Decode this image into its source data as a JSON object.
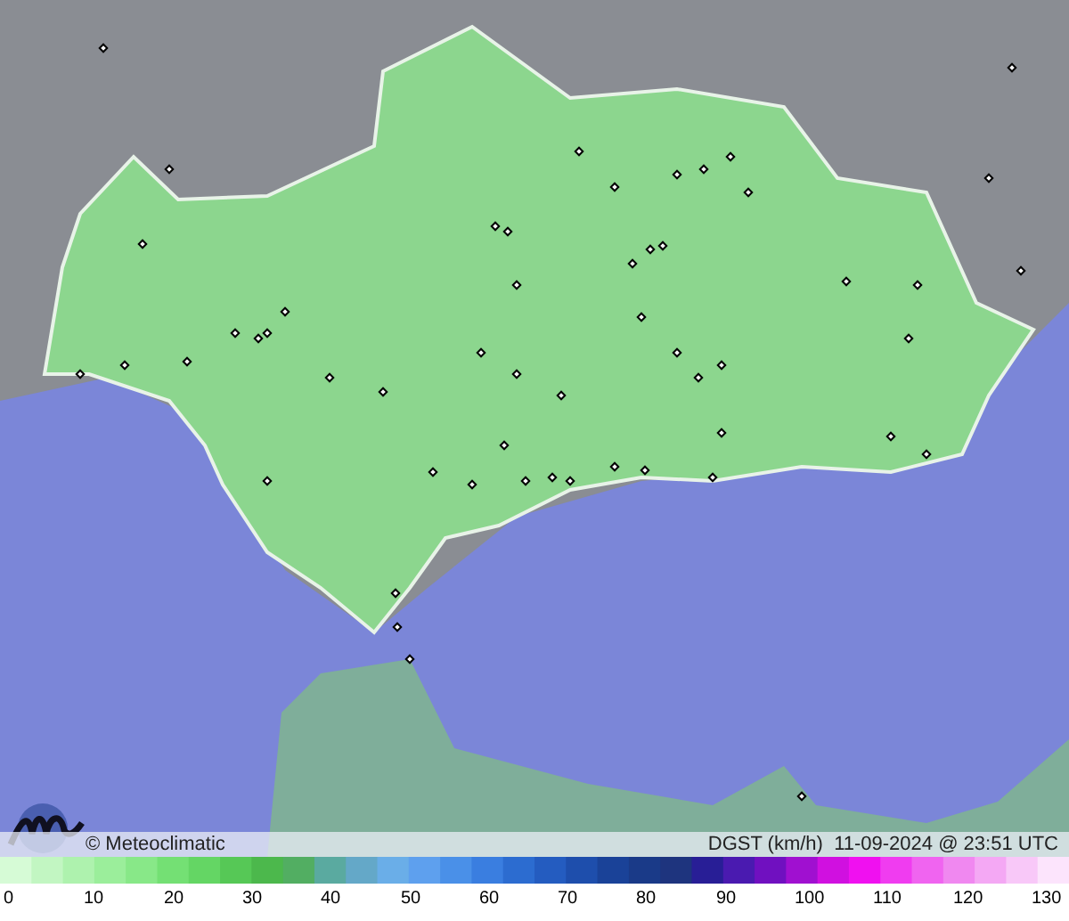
{
  "map": {
    "credit": "© Meteoclimatic",
    "caption": "DGST (km/h)  11-09-2024 @ 23:51 UTC"
  },
  "legend": {
    "ticks": [
      "0",
      "10",
      "20",
      "30",
      "40",
      "50",
      "60",
      "70",
      "80",
      "90",
      "100",
      "110",
      "120",
      "130"
    ]
  }
}
